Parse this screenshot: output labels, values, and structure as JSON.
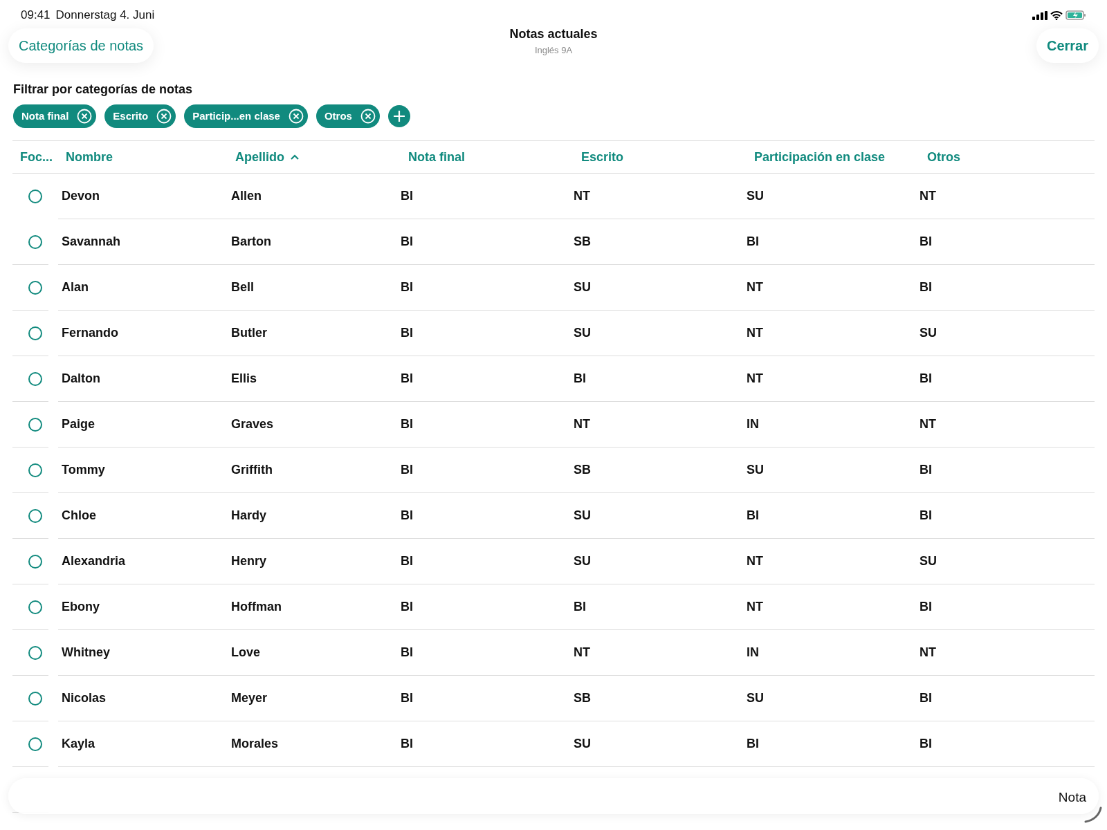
{
  "status_bar": {
    "time": "09:41",
    "date": "Donnerstag 4. Juni"
  },
  "nav": {
    "back_button": "Categorías de notas",
    "title": "Notas actuales",
    "subtitle": "Inglés 9A",
    "close_button": "Cerrar"
  },
  "filter": {
    "heading": "Filtrar por categorías de notas",
    "chips": [
      "Nota final",
      "Escrito",
      "Particip...en clase",
      "Otros"
    ]
  },
  "table": {
    "focus_column": {
      "label": "Foc..."
    },
    "columns": [
      {
        "label": "Nombre",
        "sorted": false
      },
      {
        "label": "Apellido",
        "sorted": true
      },
      {
        "label": "Nota final",
        "sorted": false
      },
      {
        "label": "Escrito",
        "sorted": false
      },
      {
        "label": "Participación en clase",
        "sorted": false
      },
      {
        "label": "Otros",
        "sorted": false
      }
    ],
    "rows": [
      {
        "selected": false,
        "cells": [
          "Devon",
          "Allen",
          "BI",
          "NT",
          "SU",
          "NT"
        ]
      },
      {
        "selected": false,
        "cells": [
          "Savannah",
          "Barton",
          "BI",
          "SB",
          "BI",
          "BI"
        ]
      },
      {
        "selected": false,
        "cells": [
          "Alan",
          "Bell",
          "BI",
          "SU",
          "NT",
          "BI"
        ]
      },
      {
        "selected": false,
        "cells": [
          "Fernando",
          "Butler",
          "BI",
          "SU",
          "NT",
          "SU"
        ]
      },
      {
        "selected": false,
        "cells": [
          "Dalton",
          "Ellis",
          "BI",
          "BI",
          "NT",
          "BI"
        ]
      },
      {
        "selected": false,
        "cells": [
          "Paige",
          "Graves",
          "BI",
          "NT",
          "IN",
          "NT"
        ]
      },
      {
        "selected": false,
        "cells": [
          "Tommy",
          "Griffith",
          "BI",
          "SB",
          "SU",
          "BI"
        ]
      },
      {
        "selected": false,
        "cells": [
          "Chloe",
          "Hardy",
          "BI",
          "SU",
          "BI",
          "BI"
        ]
      },
      {
        "selected": false,
        "cells": [
          "Alexandria",
          "Henry",
          "BI",
          "SU",
          "NT",
          "SU"
        ]
      },
      {
        "selected": false,
        "cells": [
          "Ebony",
          "Hoffman",
          "BI",
          "BI",
          "NT",
          "BI"
        ]
      },
      {
        "selected": false,
        "cells": [
          "Whitney",
          "Love",
          "BI",
          "NT",
          "IN",
          "NT"
        ]
      },
      {
        "selected": false,
        "cells": [
          "Nicolas",
          "Meyer",
          "BI",
          "SB",
          "SU",
          "BI"
        ]
      },
      {
        "selected": false,
        "cells": [
          "Kayla",
          "Morales",
          "BI",
          "SU",
          "BI",
          "BI"
        ]
      }
    ]
  },
  "bottom_bar": {
    "label": "Nota"
  }
}
